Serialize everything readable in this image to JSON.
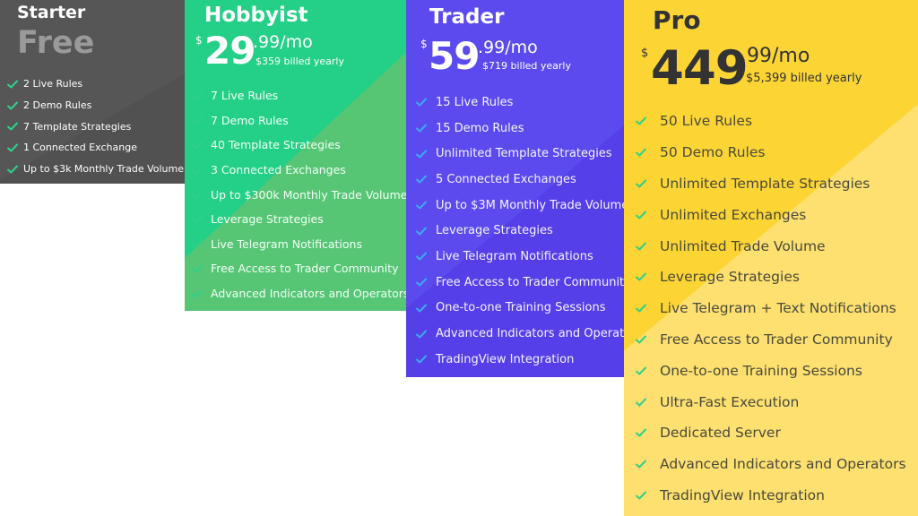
{
  "theme": {
    "starter_bg": "#565656",
    "hobbyist_bg": "#24cf87",
    "trader_bg": "#5b4bef",
    "pro_bg": "#fcd535",
    "check_green": "#2fd08a",
    "check_blue": "#3fa8f2"
  },
  "plans": {
    "starter": {
      "name": "Starter",
      "price_label": "Free",
      "features": [
        "2 Live Rules",
        "2 Demo Rules",
        "7 Template Strategies",
        "1 Connected Exchange",
        "Up to $3k Monthly Trade Volume"
      ]
    },
    "hobbyist": {
      "name": "Hobbyist",
      "currency": "$",
      "price_whole": "29",
      "price_cents": ".99/mo",
      "billed_yearly": "$359 billed yearly",
      "features": [
        "7 Live Rules",
        "7 Demo Rules",
        "40 Template Strategies",
        "3 Connected Exchanges",
        "Up to $300k Monthly Trade Volume",
        "Leverage Strategies",
        "Live Telegram Notifications",
        "Free Access to Trader Community",
        "Advanced Indicators and Operators"
      ]
    },
    "trader": {
      "name": "Trader",
      "currency": "$",
      "price_whole": "59",
      "price_cents": ".99/mo",
      "billed_yearly": "$719 billed yearly",
      "features": [
        "15 Live Rules",
        "15 Demo Rules",
        "Unlimited Template Strategies",
        "5 Connected Exchanges",
        "Up to $3M Monthly Trade Volume",
        "Leverage Strategies",
        "Live Telegram Notifications",
        "Free Access to Trader Community",
        "One-to-one Training Sessions",
        "Advanced Indicators and Operators",
        "TradingView Integration"
      ]
    },
    "pro": {
      "name": "Pro",
      "currency": "$",
      "price_whole": "449",
      "price_cents": ".99/mo",
      "billed_yearly": "$5,399 billed yearly",
      "features": [
        "50 Live Rules",
        "50 Demo Rules",
        "Unlimited Template Strategies",
        "Unlimited Exchanges",
        "Unlimited Trade Volume",
        "Leverage Strategies",
        "Live Telegram + Text Notifications",
        "Free Access to Trader Community",
        "One-to-one Training Sessions",
        "Ultra-Fast Execution",
        "Dedicated Server",
        "Advanced Indicators and Operators",
        "TradingView Integration"
      ]
    }
  }
}
